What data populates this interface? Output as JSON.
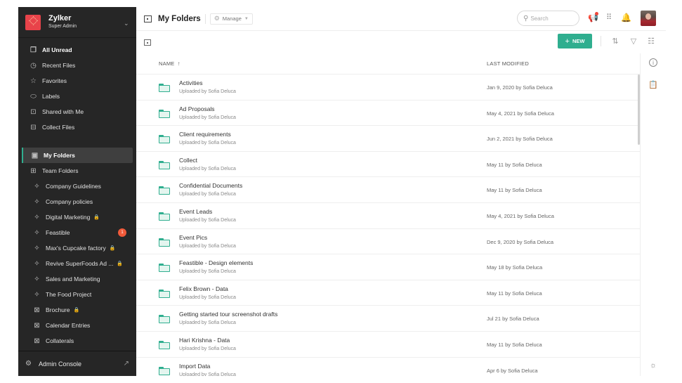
{
  "org": {
    "name": "Zylker",
    "role": "Super Admin"
  },
  "sidebar": {
    "top_items": [
      {
        "label": "All Unread",
        "icon": "unread-icon",
        "glyph": "❐",
        "bold": true
      },
      {
        "label": "Recent Files",
        "icon": "clock-icon",
        "glyph": "◷"
      },
      {
        "label": "Favorites",
        "icon": "star-icon",
        "glyph": "☆"
      },
      {
        "label": "Labels",
        "icon": "label-icon",
        "glyph": "⬭"
      },
      {
        "label": "Shared with Me",
        "icon": "shared-icon",
        "glyph": "⊡"
      },
      {
        "label": "Collect Files",
        "icon": "collect-icon",
        "glyph": "⊟"
      }
    ],
    "my_folders": {
      "label": "My Folders",
      "icon": "my-folders-icon",
      "glyph": "▣"
    },
    "team_folders": {
      "label": "Team Folders",
      "icon": "team-folders-icon",
      "glyph": "⊞"
    },
    "team_items": [
      {
        "label": "Company Guidelines",
        "icon": "pin-icon",
        "glyph": "✧"
      },
      {
        "label": "Company policies",
        "icon": "pin-icon",
        "glyph": "✧"
      },
      {
        "label": "Digital Marketing",
        "icon": "pin-icon",
        "glyph": "✧",
        "locked": true
      },
      {
        "label": "Feastible",
        "icon": "pin-icon",
        "glyph": "✧",
        "badge": "1"
      },
      {
        "label": "Max's Cupcake factory",
        "icon": "pin-icon",
        "glyph": "✧",
        "locked": true
      },
      {
        "label": "Revive SuperFoods Ad ...",
        "icon": "pin-icon",
        "glyph": "✧",
        "locked": true
      },
      {
        "label": "Sales and Marketing",
        "icon": "pin-icon",
        "glyph": "✧"
      },
      {
        "label": "The Food Project",
        "icon": "pin-icon",
        "glyph": "✧"
      },
      {
        "label": "Brochure",
        "icon": "team-folder-icon",
        "glyph": "⊠",
        "locked": true
      },
      {
        "label": "Calendar Entries",
        "icon": "team-folder-icon",
        "glyph": "⊠"
      },
      {
        "label": "Collaterals",
        "icon": "team-folder-icon",
        "glyph": "⊠"
      }
    ],
    "lock_glyph": "🔒",
    "admin": {
      "label": "Admin Console"
    }
  },
  "header": {
    "title": "My Folders",
    "manage_label": "Manage",
    "search_placeholder": "Search"
  },
  "toolbar": {
    "new_label": "NEW"
  },
  "list": {
    "col_name": "NAME",
    "col_modified": "LAST MODIFIED",
    "rows": [
      {
        "name": "Activities",
        "sub": "Uploaded by Sofia Deluca",
        "modified": "Jan 9, 2020 by Sofia Deluca"
      },
      {
        "name": "Ad Proposals",
        "sub": "Uploaded by Sofia Deluca",
        "modified": "May 4, 2021 by Sofia Deluca"
      },
      {
        "name": "Client requirements",
        "sub": "Uploaded by Sofia Deluca",
        "modified": "Jun 2, 2021 by Sofia Deluca"
      },
      {
        "name": "Collect",
        "sub": "Uploaded by Sofia Deluca",
        "modified": "May 11 by Sofia Deluca"
      },
      {
        "name": "Confidential Documents",
        "sub": "Uploaded by Sofia Deluca",
        "modified": "May 11 by Sofia Deluca"
      },
      {
        "name": "Event Leads",
        "sub": "Uploaded by Sofia Deluca",
        "modified": "May 4, 2021 by Sofia Deluca"
      },
      {
        "name": "Event Pics",
        "sub": "Uploaded by Sofia Deluca",
        "modified": "Dec 9, 2020 by Sofia Deluca"
      },
      {
        "name": "Feastible - Design elements",
        "sub": "Uploaded by Sofia Deluca",
        "modified": "May 18 by Sofia Deluca"
      },
      {
        "name": "Felix Brown - Data",
        "sub": "Uploaded by Sofia Deluca",
        "modified": "May 11 by Sofia Deluca"
      },
      {
        "name": "Getting started tour screenshot drafts",
        "sub": "Uploaded by Sofia Deluca",
        "modified": "Jul 21 by Sofia Deluca"
      },
      {
        "name": "Hari Krishna - Data",
        "sub": "Uploaded by Sofia Deluca",
        "modified": "May 11 by Sofia Deluca"
      },
      {
        "name": "Import Data",
        "sub": "Uploaded by Sofia Deluca",
        "modified": "Apr 6 by Sofia Deluca"
      }
    ]
  },
  "colors": {
    "accent": "#2fae8f",
    "sidebar_bg": "#262626",
    "badge": "#f15a3a",
    "logo": "#e8434a"
  }
}
